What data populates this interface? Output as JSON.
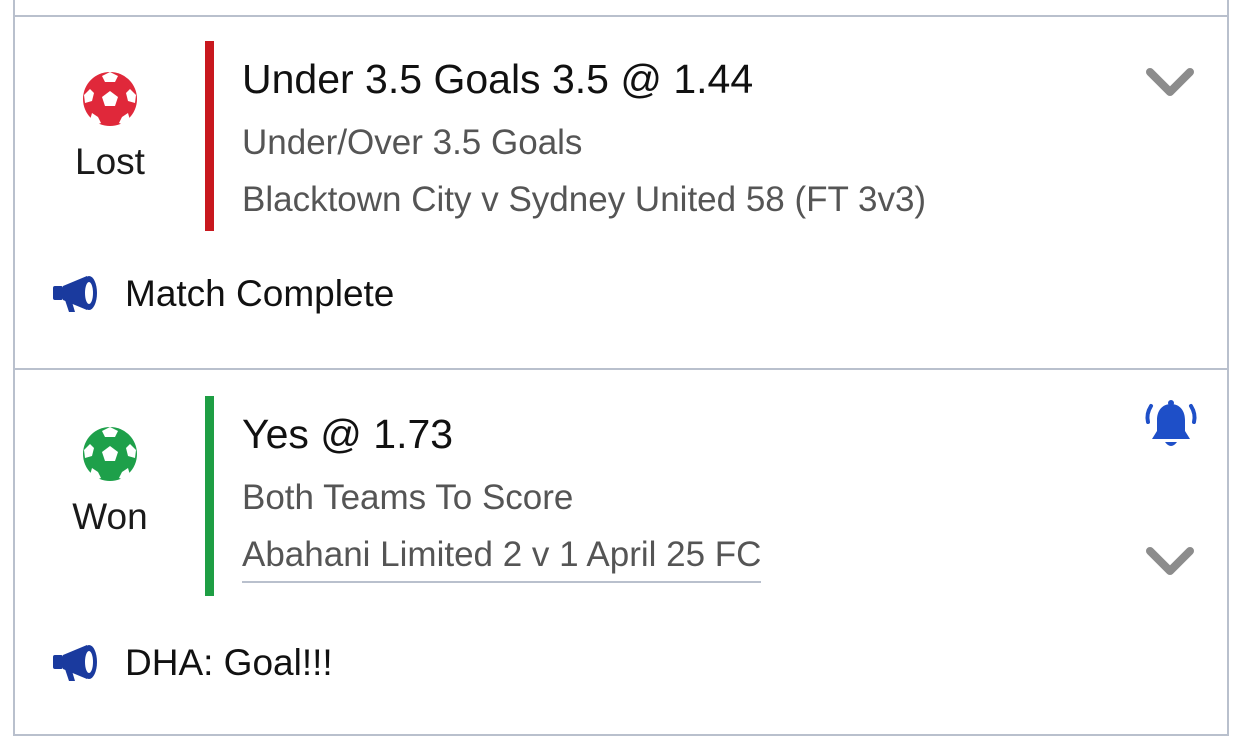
{
  "bets": [
    {
      "status": "Lost",
      "status_color": "#e0283a",
      "bar_color": "#c8181e",
      "selection": "Under 3.5 Goals 3.5 @ 1.44",
      "market": "Under/Over 3.5 Goals",
      "event": "Blacktown City v Sydney United 58 (FT 3v3)",
      "update": "Match Complete",
      "icons": [
        "soccer-ball-icon",
        "chevron-down-icon",
        "megaphone-icon"
      ]
    },
    {
      "status": "Won",
      "status_color": "#1ea04a",
      "bar_color": "#1e9e44",
      "selection": "Yes @ 1.73",
      "market": "Both Teams To Score",
      "event": "Abahani Limited 2 v 1 April 25 FC",
      "update": "DHA: Goal!!!",
      "icons": [
        "soccer-ball-icon",
        "bell-icon",
        "chevron-down-icon",
        "megaphone-icon"
      ]
    }
  ],
  "colors": {
    "border": "#b9c0cd",
    "chevron": "#8c8c8c",
    "accent_blue": "#1e4fc8",
    "megaphone": "#1a3a9e"
  }
}
